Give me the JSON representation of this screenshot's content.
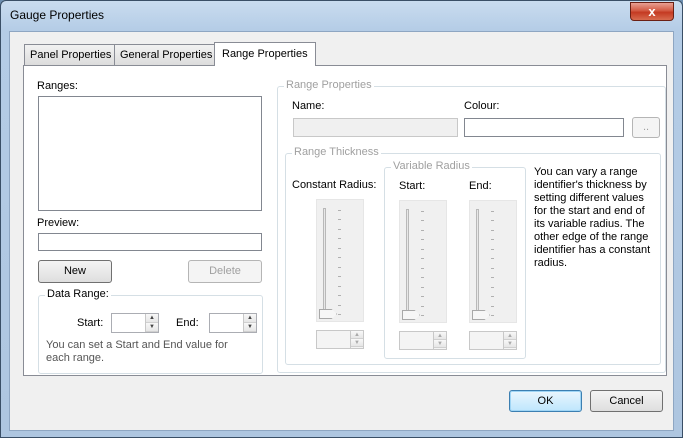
{
  "window": {
    "title": "Gauge Properties",
    "close_glyph": "x"
  },
  "tabs": [
    {
      "label": "Panel Properties",
      "active": false
    },
    {
      "label": "General Properties",
      "active": false
    },
    {
      "label": "Range Properties",
      "active": true
    }
  ],
  "left": {
    "ranges_label": "Ranges:",
    "preview_label": "Preview:",
    "new_button": "New",
    "delete_button": "Delete",
    "data_range": {
      "title": "Data Range:",
      "start_label": "Start:",
      "end_label": "End:",
      "start_value": "",
      "end_value": "",
      "hint": "You can set a Start and End value for each range."
    }
  },
  "range_properties": {
    "title": "Range Properties",
    "name_label": "Name:",
    "name_value": "",
    "colour_label": "Colour:",
    "colour_value": "",
    "colour_button": "..",
    "thickness": {
      "title": "Range Thickness",
      "constant_label": "Constant Radius:",
      "variable_title": "Variable Radius",
      "start_label": "Start:",
      "end_label": "End:",
      "constant_value": "",
      "start_value": "",
      "end_value": "",
      "help_text": "You can vary a range identifier's thickness by setting different values for the start and end of its variable radius. The other edge of the range identifier has a constant radius."
    }
  },
  "footer": {
    "ok_button": "OK",
    "cancel_button": "Cancel"
  }
}
